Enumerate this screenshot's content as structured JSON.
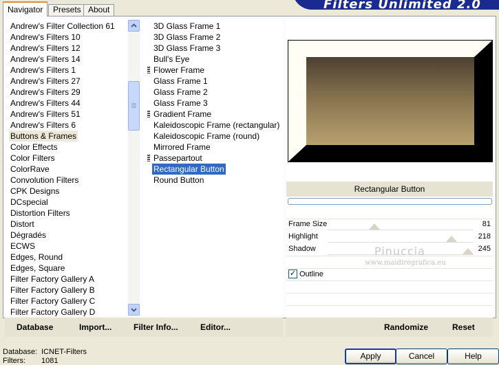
{
  "banner": {
    "title": "Filters Unlimited 2.0"
  },
  "tabs": [
    {
      "label": "Navigator"
    },
    {
      "label": "Presets"
    },
    {
      "label": "About"
    }
  ],
  "categories": [
    "Andrew's Filter Collection 61",
    "Andrew's Filters 10",
    "Andrew's Filters 12",
    "Andrew's Filters 14",
    "Andrew's Filters 1",
    "Andrew's Filters 27",
    "Andrew's Filters 29",
    "Andrew's Filters 44",
    "Andrew's Filters 51",
    "Andrew's Filters 6",
    "Buttons & Frames",
    "Color Effects",
    "Color Filters",
    "ColorRave",
    "Convolution Filters",
    "CPK Designs",
    "DCspecial",
    "Distortion Filters",
    "Distort",
    "Dégradés",
    "ECWS",
    "Edges, Round",
    "Edges, Square",
    "Filter Factory Gallery A",
    "Filter Factory Gallery B",
    "Filter Factory Gallery C",
    "Filter Factory Gallery D"
  ],
  "selected_category": "Buttons & Frames",
  "filters": [
    {
      "label": "3D Glass Frame 1",
      "marker": false
    },
    {
      "label": "3D Glass Frame 2",
      "marker": false
    },
    {
      "label": "3D Glass Frame 3",
      "marker": false
    },
    {
      "label": "Bull's Eye",
      "marker": false
    },
    {
      "label": "Flower Frame",
      "marker": true
    },
    {
      "label": "Glass Frame 1",
      "marker": false
    },
    {
      "label": "Glass Frame 2",
      "marker": false
    },
    {
      "label": "Glass Frame 3",
      "marker": false
    },
    {
      "label": "Gradient Frame",
      "marker": true
    },
    {
      "label": "Kaleidoscopic Frame (rectangular)",
      "marker": false
    },
    {
      "label": "Kaleidoscopic Frame (round)",
      "marker": false
    },
    {
      "label": "Mirrored Frame",
      "marker": false
    },
    {
      "label": "Passepartout",
      "marker": true
    },
    {
      "label": "Rectangular Button",
      "marker": false
    },
    {
      "label": "Round Button",
      "marker": false
    }
  ],
  "selected_filter": "Rectangular Button",
  "filter_name": "Rectangular Button",
  "params": [
    {
      "label": "Frame Size",
      "value": "81",
      "level": 0.32
    },
    {
      "label": "Highlight",
      "value": "218",
      "level": 0.85
    },
    {
      "label": "Shadow",
      "value": "245",
      "level": 0.96
    }
  ],
  "outline": {
    "label": "Outline",
    "checked": true
  },
  "watermark": {
    "name": "Pinuccia",
    "site": "www.maidiregrafica.eu"
  },
  "left_buttons": {
    "database": "Database",
    "import": "Import...",
    "filter_info": "Filter Info...",
    "editor": "Editor..."
  },
  "right_buttons": {
    "randomize": "Randomize",
    "reset": "Reset"
  },
  "status": {
    "database_label": "Database:",
    "database_value": "ICNET-Filters",
    "filters_label": "Filters:",
    "filters_value": "1081"
  },
  "dialog_buttons": {
    "apply": "Apply",
    "cancel": "Cancel",
    "help": "Help"
  },
  "colors": {
    "selection": "#316ac5",
    "banner": "#1b2a8f",
    "panel": "#ece9d8"
  }
}
